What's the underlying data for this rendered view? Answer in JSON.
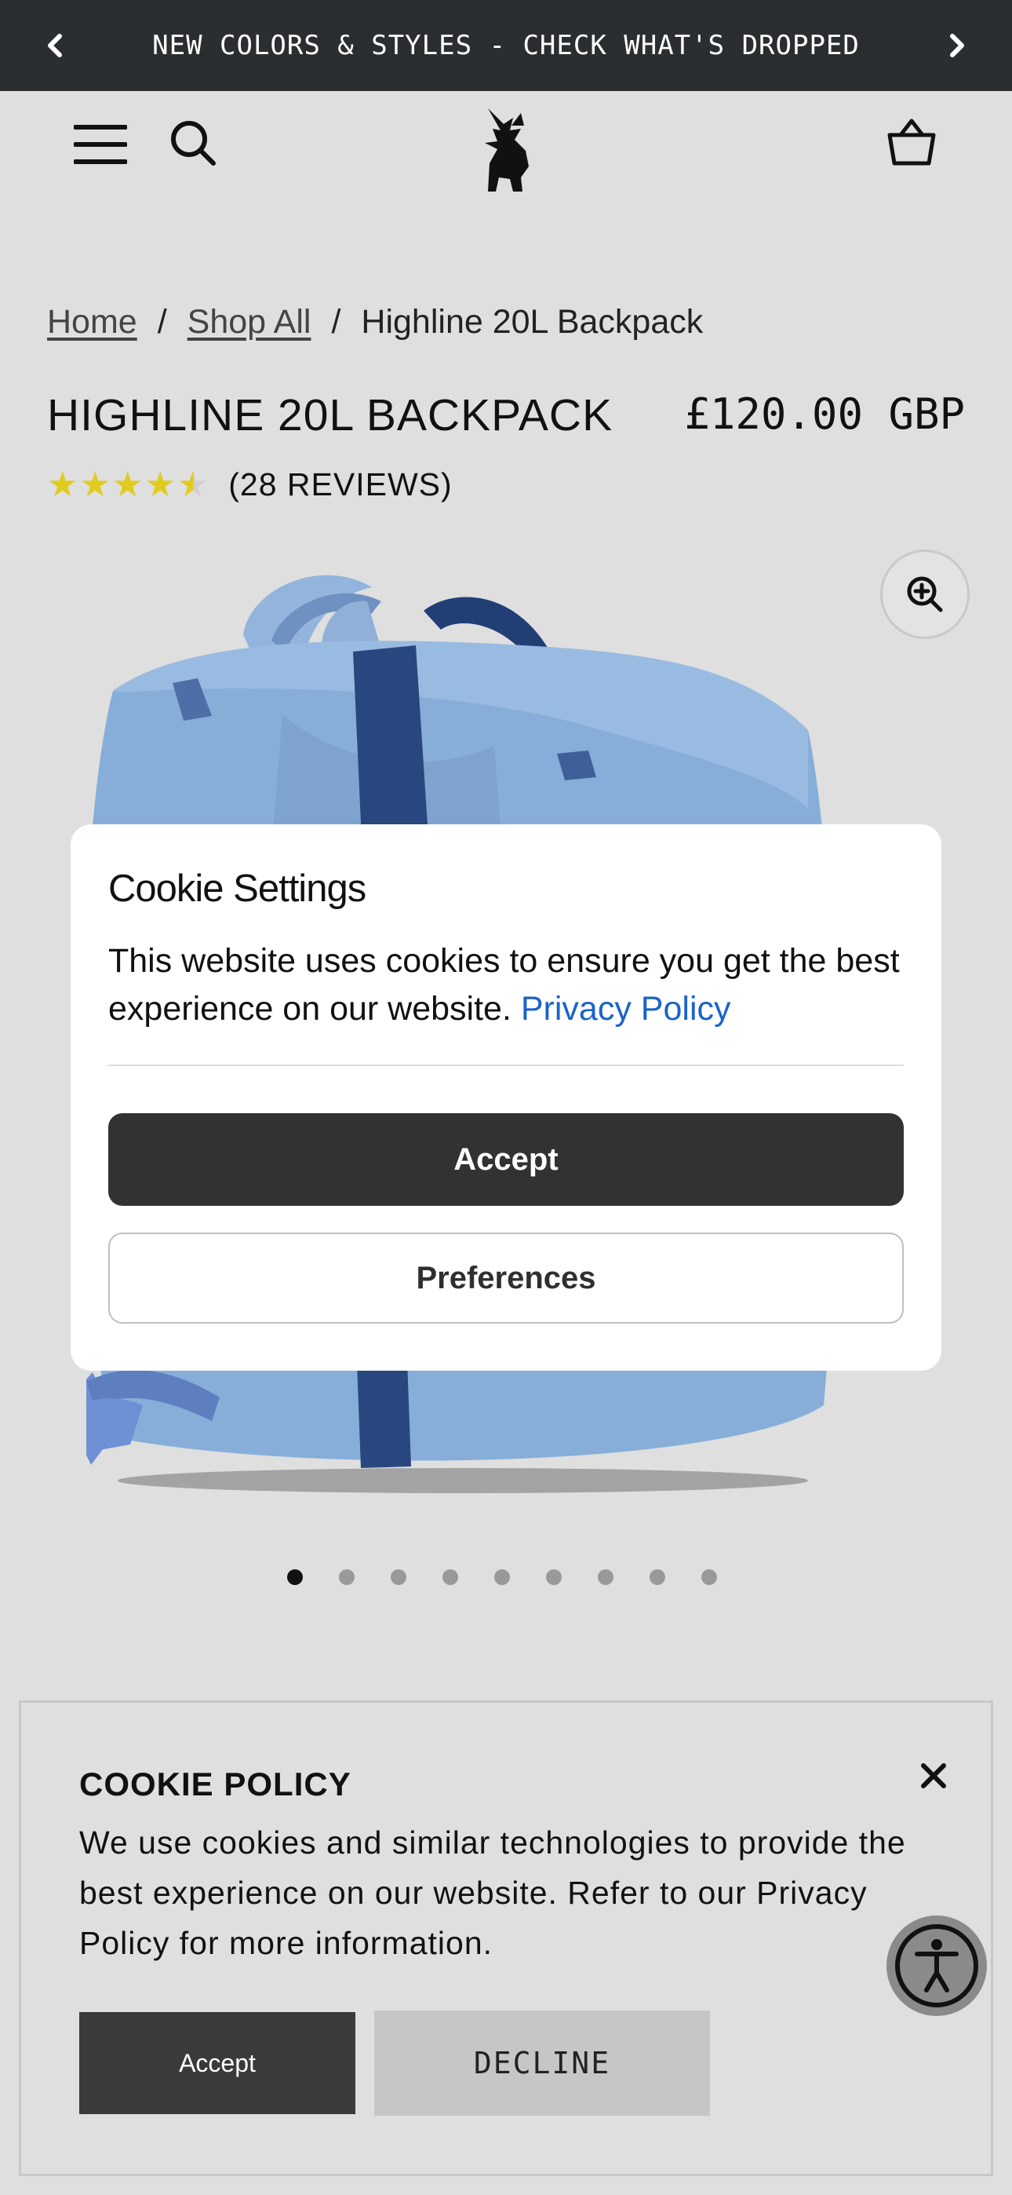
{
  "announcement": {
    "text": "NEW COLORS & STYLES - CHECK WHAT'S DROPPED"
  },
  "header": {
    "menu_icon": "hamburger-icon",
    "search_icon": "search-icon",
    "logo": "griffin-logo",
    "cart_icon": "cart-icon"
  },
  "breadcrumb": {
    "home": "Home",
    "shop_all": "Shop All",
    "current": "Highline 20L Backpack",
    "separator": "/"
  },
  "product": {
    "title": "HIGHLINE 20L BACKPACK",
    "price": "£120.00 GBP",
    "rating": 4.5,
    "reviews": "(28 REVIEWS)",
    "color": "#86aed8"
  },
  "carousel": {
    "count": 9,
    "active_index": 0
  },
  "cookie_modal": {
    "title": "Cookie Settings",
    "body": "This website uses cookies to ensure you get the best experience on our website.",
    "link": "Privacy Policy",
    "accept": "Accept",
    "preferences": "Preferences"
  },
  "cookie_policy": {
    "title": "COOKIE POLICY",
    "body": "We use cookies and similar technologies to provide the best experience on our website. Refer to our Privacy Policy for more information.",
    "accept": "Accept",
    "decline": "DECLINE"
  }
}
